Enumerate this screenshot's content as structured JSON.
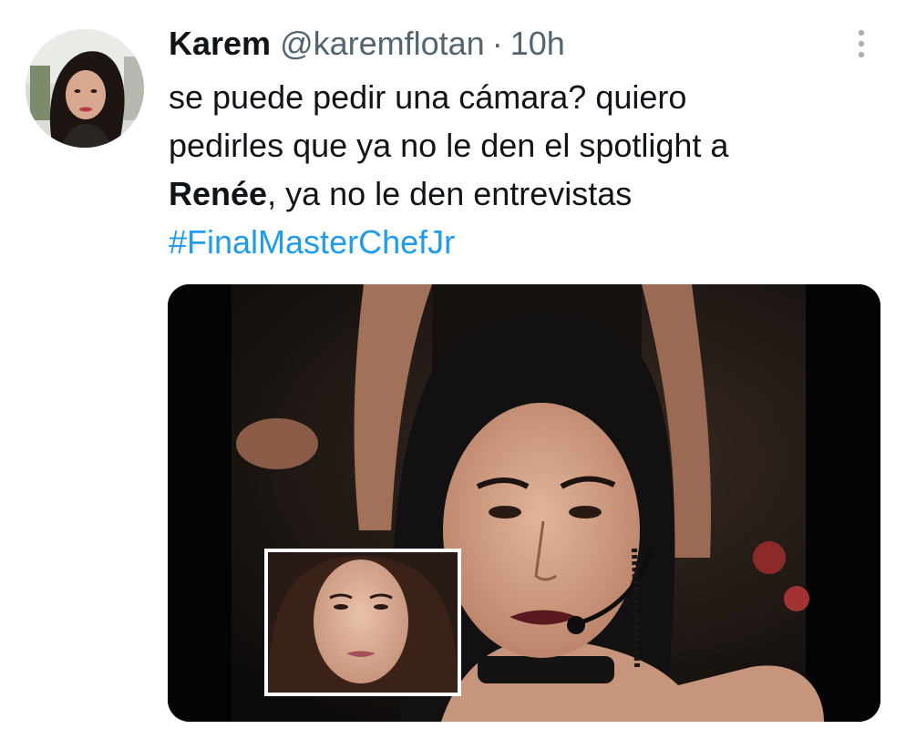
{
  "tweet": {
    "author": {
      "display_name": "Karem",
      "handle": "@karemflotan",
      "separator": "·",
      "time": "10h",
      "avatar_icon": "profile-photo"
    },
    "text": {
      "line1": "se puede pedir una cámara? quiero",
      "line2": "pedirles que ya no le den el spotlight a",
      "line3_bold": "Renée",
      "line3_rest": ", ya no le den entrevistas",
      "hashtag": "#FinalMasterChefJr"
    },
    "more_icon": "more-vertical-icon",
    "media": {
      "kind": "photo",
      "inset": "inset-portrait-photo"
    }
  },
  "colors": {
    "text": "#0f1419",
    "secondary": "#536471",
    "link": "#1d9bf0",
    "background": "#ffffff"
  }
}
